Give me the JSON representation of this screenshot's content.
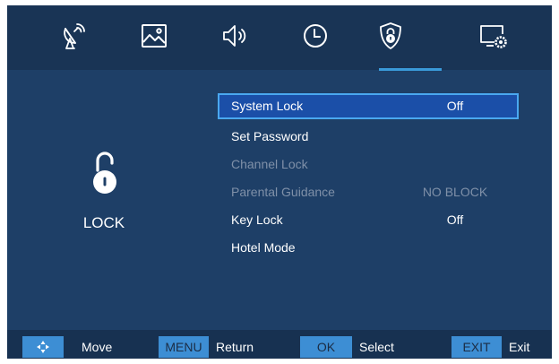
{
  "tabs": [
    {
      "icon": "satellite-dish-icon",
      "active": false
    },
    {
      "icon": "picture-icon",
      "active": false
    },
    {
      "icon": "speaker-icon",
      "active": false
    },
    {
      "icon": "clock-icon",
      "active": false
    },
    {
      "icon": "shield-lock-icon",
      "active": true
    },
    {
      "icon": "monitor-settings-icon",
      "active": false
    }
  ],
  "section": {
    "icon": "padlock-icon",
    "title": "LOCK"
  },
  "menu": {
    "items": [
      {
        "label": "System Lock",
        "value": "Off",
        "selected": true,
        "enabled": true
      },
      {
        "label": "Set Password",
        "value": "",
        "selected": false,
        "enabled": true
      },
      {
        "label": "Channel Lock",
        "value": "",
        "selected": false,
        "enabled": false
      },
      {
        "label": "Parental Guidance",
        "value": "NO BLOCK",
        "selected": false,
        "enabled": false
      },
      {
        "label": "Key Lock",
        "value": "Off",
        "selected": false,
        "enabled": true
      },
      {
        "label": "Hotel Mode",
        "value": "",
        "selected": false,
        "enabled": true
      }
    ]
  },
  "footer": {
    "move": {
      "key_icon": "dpad-arrows-icon",
      "label": "Move"
    },
    "menu": {
      "key": "MENU",
      "label": "Return"
    },
    "ok": {
      "key": "OK",
      "label": "Select"
    },
    "exit": {
      "key": "EXIT",
      "label": "Exit"
    }
  },
  "colors": {
    "background": "#1e3f67",
    "tabbar": "#193455",
    "highlight": "#1b4fa8",
    "highlight_border": "#4aa8f0",
    "footer_key": "#3d8ed4",
    "disabled_text": "#7f90a8"
  }
}
